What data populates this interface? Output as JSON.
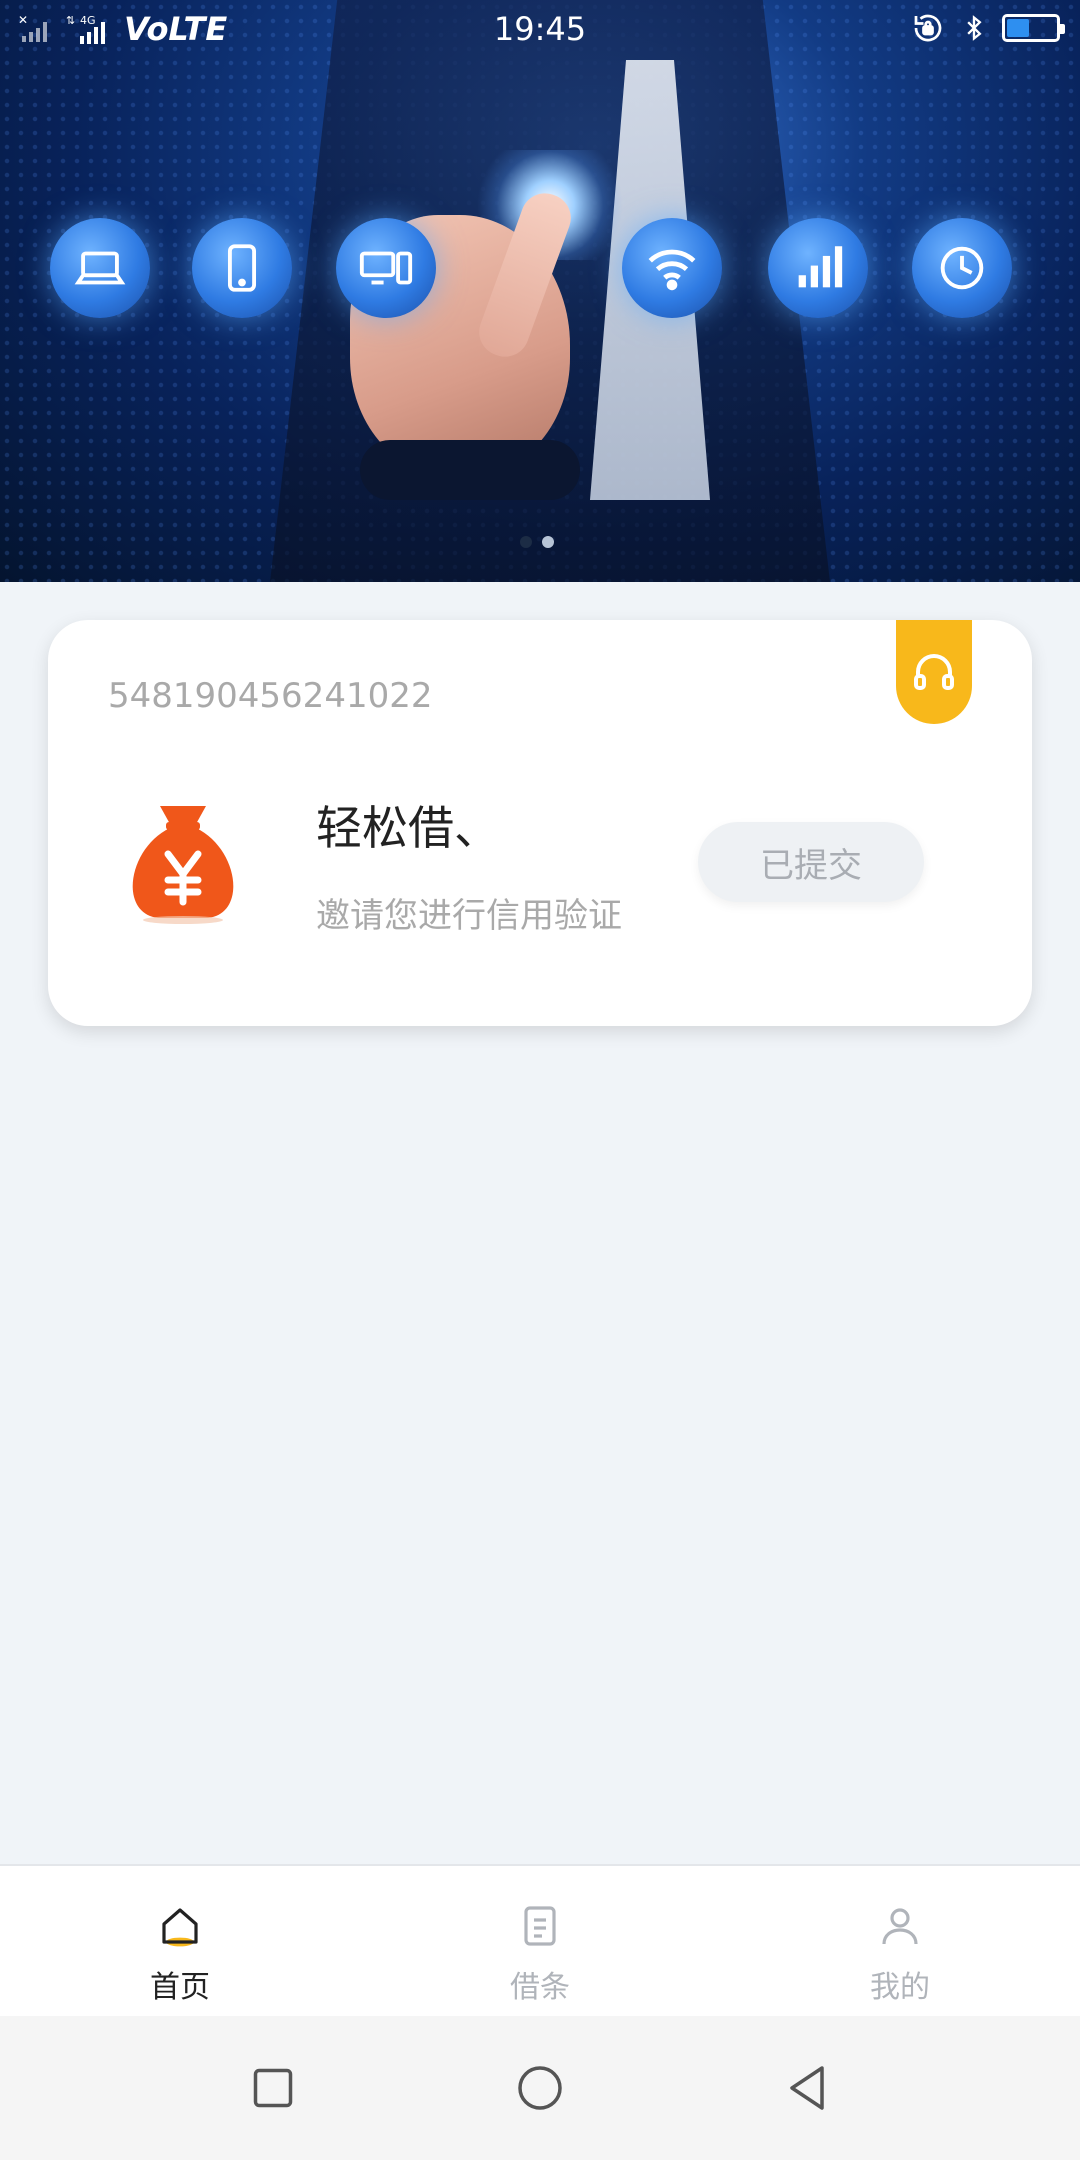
{
  "status_bar": {
    "network": "4G",
    "volte": "VoLTE",
    "time": "19:45",
    "battery_level": 0.45
  },
  "banner": {
    "carousel_total": 2,
    "carousel_active": 2
  },
  "card": {
    "order_number": "548190456241022",
    "product_name": "轻松借、",
    "product_desc": "邀请您进行信用验证",
    "status_button": "已提交",
    "support_tag_color": "#f8b81b",
    "logo_color": "#f0571a"
  },
  "tabs": [
    {
      "label": "首页",
      "icon": "home-icon",
      "active": true
    },
    {
      "label": "借条",
      "icon": "document-icon",
      "active": false
    },
    {
      "label": "我的",
      "icon": "person-icon",
      "active": false
    }
  ],
  "system_nav": [
    "recent-apps-icon",
    "home-circle-icon",
    "back-triangle-icon"
  ]
}
